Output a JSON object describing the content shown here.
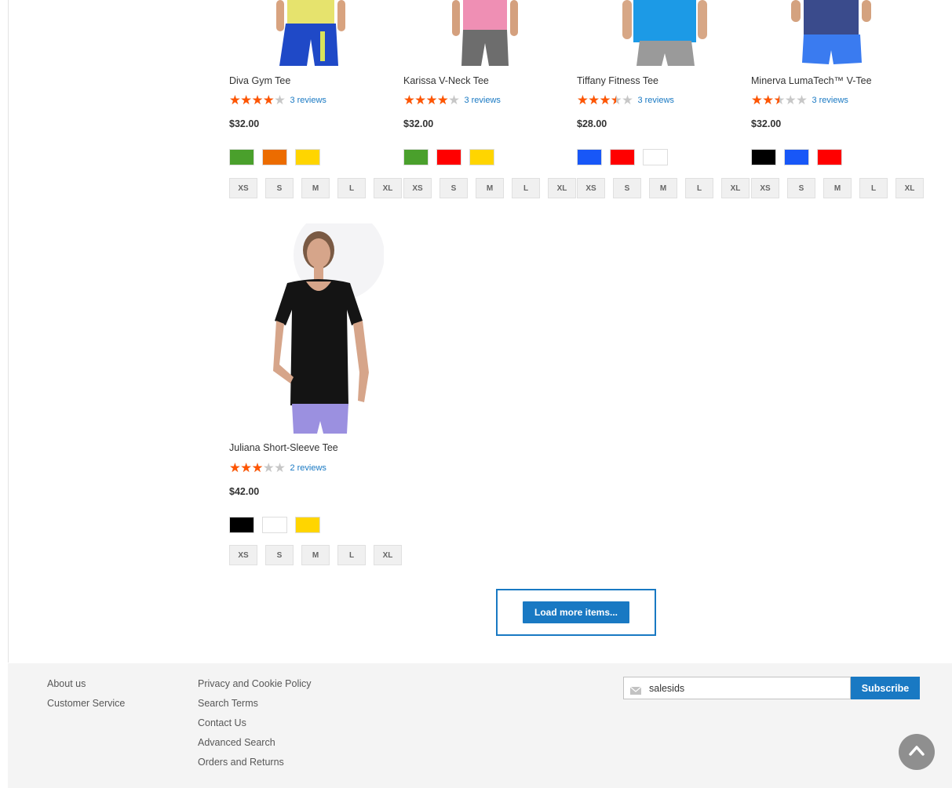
{
  "products": [
    {
      "name": "Diva Gym Tee",
      "rating_fraction": 0.8,
      "reviews": "3 reviews",
      "price": "$32.00",
      "colors": [
        "#4aa02c",
        "#ec6c00",
        "#ffd500"
      ],
      "sizes": [
        "XS",
        "S",
        "M",
        "L",
        "XL"
      ],
      "image": "model-yellow-top-blue-pants"
    },
    {
      "name": "Karissa V-Neck Tee",
      "rating_fraction": 0.8,
      "reviews": "3 reviews",
      "price": "$32.00",
      "colors": [
        "#4aa02c",
        "#ff0000",
        "#ffd500"
      ],
      "sizes": [
        "XS",
        "S",
        "M",
        "L",
        "XL"
      ],
      "image": "model-pink-top-gray-pants"
    },
    {
      "name": "Tiffany Fitness Tee",
      "rating_fraction": 0.7,
      "reviews": "3 reviews",
      "price": "$28.00",
      "colors": [
        "#1857f7",
        "#ff0000",
        "#ffffff"
      ],
      "sizes": [
        "XS",
        "S",
        "M",
        "L",
        "XL"
      ],
      "image": "model-blue-top-gray-pants"
    },
    {
      "name": "Minerva LumaTech™ V-Tee",
      "rating_fraction": 0.5,
      "reviews": "3 reviews",
      "price": "$32.00",
      "colors": [
        "#000000",
        "#1857f7",
        "#ff0000"
      ],
      "sizes": [
        "XS",
        "S",
        "M",
        "L",
        "XL"
      ],
      "image": "model-navy-top-blue-shorts"
    },
    {
      "name": "Juliana Short-Sleeve Tee",
      "rating_fraction": 0.6,
      "reviews": "2 reviews",
      "price": "$42.00",
      "colors": [
        "#000000",
        "#ffffff",
        "#ffd500"
      ],
      "sizes": [
        "XS",
        "S",
        "M",
        "L",
        "XL"
      ],
      "image": "model-black-tee-lavender-pants"
    }
  ],
  "load_more": {
    "label": "Load more items..."
  },
  "footer": {
    "col1": [
      "About us",
      "Customer Service"
    ],
    "col2": [
      "Privacy and Cookie Policy",
      "Search Terms",
      "Contact Us",
      "Advanced Search",
      "Orders and Returns"
    ],
    "newsletter": {
      "value": "salesids",
      "icon": "mail-icon",
      "button": "Subscribe"
    },
    "back_to_top_icon": "chevron-up-icon"
  },
  "theme": {
    "accent": "#1979c3",
    "star_color": "#ff5501",
    "star_empty": "#c7c7c7",
    "footer_bg": "#f4f4f4"
  }
}
